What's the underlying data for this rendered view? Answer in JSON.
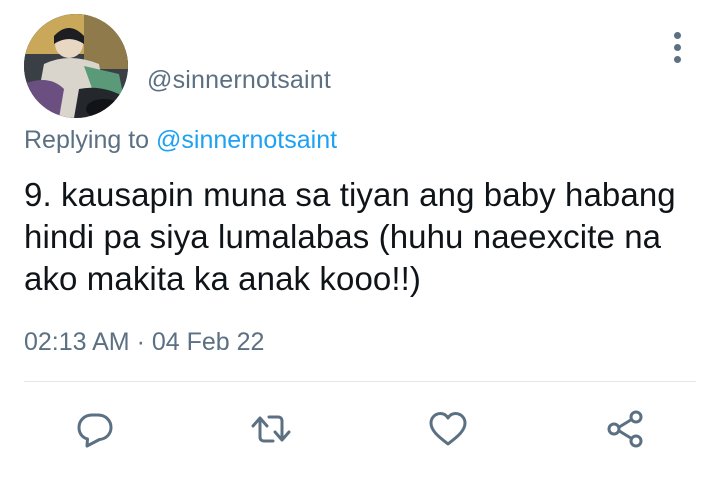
{
  "author": {
    "handle": "@sinnernotsaint"
  },
  "reply_context": {
    "prefix": "Replying to",
    "mention": "@sinnernotsaint"
  },
  "tweet": {
    "text": "9. kausapin muna sa tiyan ang baby habang hindi pa siya lumalabas (huhu naeexcite na ako makita ka anak kooo!!)",
    "time": "02:13 AM",
    "separator": "·",
    "date": "04 Feb 22"
  },
  "actions": [
    {
      "icon": "reply-icon"
    },
    {
      "icon": "retweet-icon"
    },
    {
      "icon": "like-icon"
    },
    {
      "icon": "share-icon"
    }
  ],
  "colors": {
    "text": "#0f1419",
    "secondary": "#5b7083",
    "link": "#1da1f2",
    "divider": "#e1e8ed"
  }
}
